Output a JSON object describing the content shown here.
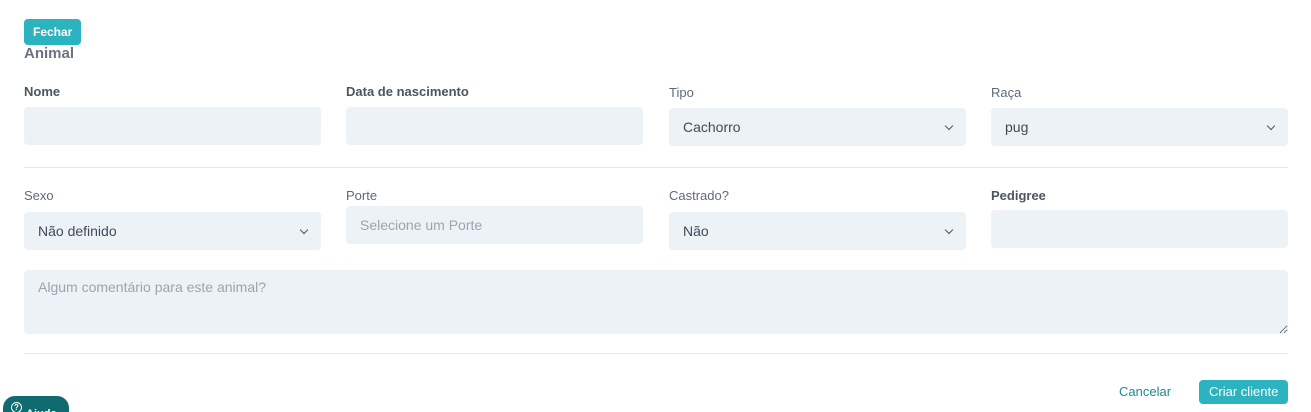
{
  "header": {
    "close_label": "Fechar",
    "section_title": "Animal"
  },
  "form": {
    "nome": {
      "label": "Nome",
      "value": ""
    },
    "nascimento": {
      "label": "Data de nascimento",
      "value": ""
    },
    "tipo": {
      "label": "Tipo",
      "selected": "Cachorro"
    },
    "raca": {
      "label": "Raça",
      "selected": "pug"
    },
    "sexo": {
      "label": "Sexo",
      "selected": "Não definido"
    },
    "porte": {
      "label": "Porte",
      "placeholder": "Selecione um Porte"
    },
    "castrado": {
      "label": "Castrado?",
      "selected": "Não"
    },
    "pedigree": {
      "label": "Pedigree",
      "value": ""
    },
    "comentario": {
      "placeholder": "Algum comentário para este animal?"
    }
  },
  "footer": {
    "cancel_label": "Cancelar",
    "create_label": "Criar cliente"
  },
  "help": {
    "label": "Ajuda",
    "icon": "question-circle-icon"
  },
  "colors": {
    "accent": "#2bb3c0",
    "help_bg": "#0f6b6f",
    "field_bg": "#edf2f7"
  }
}
